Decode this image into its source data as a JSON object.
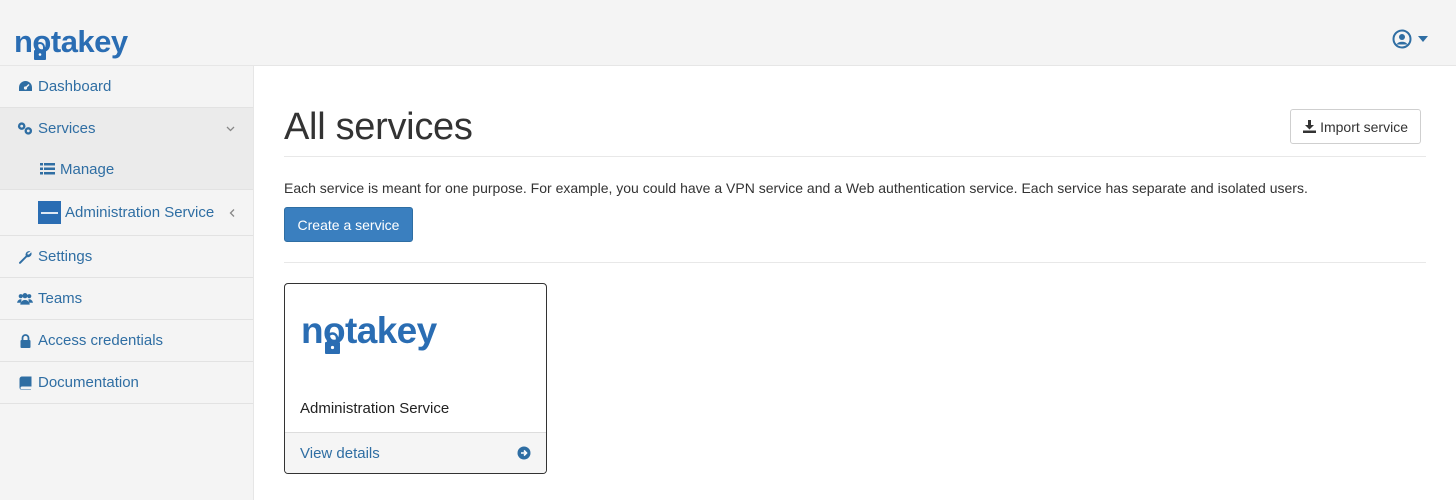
{
  "brand": {
    "logo_text": "notakey",
    "color": "#2a6db3"
  },
  "header": {
    "user_icon": "user-circle-icon",
    "caret_icon": "caret-down-icon"
  },
  "sidebar": {
    "items": [
      {
        "label": "Dashboard",
        "icon": "dashboard-icon"
      },
      {
        "label": "Services",
        "icon": "services-icon"
      },
      {
        "label": "Manage",
        "icon": "list-icon"
      },
      {
        "label": "Administration Service",
        "icon": "service-thumbnail"
      },
      {
        "label": "Settings",
        "icon": "wrench-icon"
      },
      {
        "label": "Teams",
        "icon": "users-icon"
      },
      {
        "label": "Access credentials",
        "icon": "lock-icon"
      },
      {
        "label": "Documentation",
        "icon": "book-icon"
      }
    ]
  },
  "main": {
    "title": "All services",
    "import_label": "Import service",
    "description": "Each service is meant for one purpose. For example, you could have a VPN service and a Web authentication service. Each service has separate and isolated users.",
    "create_label": "Create a service",
    "services": [
      {
        "name": "Administration Service",
        "logo_text": "notakey",
        "link_label": "View details"
      }
    ]
  },
  "colors": {
    "accent": "#3a7fbf",
    "link": "#2f6ea3",
    "sidebar_bg": "#f4f4f4"
  }
}
